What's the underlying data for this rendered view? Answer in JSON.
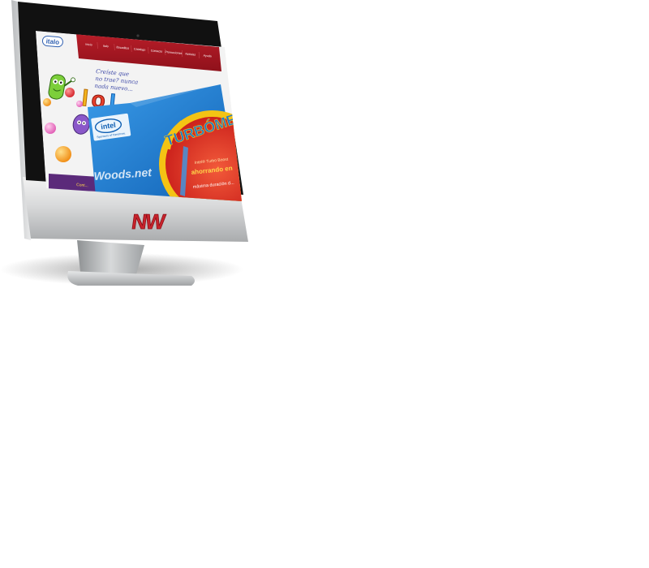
{
  "colors": {
    "nav_red": "#a51722",
    "nav_red_dark": "#7d0f18",
    "intel_blue": "#1a78d4",
    "turbo_yellow": "#f4c314",
    "turbo_red": "#e0301f",
    "brand_red": "#c8232c",
    "bezel": "#111111",
    "chin_silver": "#d9dadb"
  },
  "website": {
    "logo": "italo",
    "nav_items": [
      "Inicio",
      "Italo",
      "Bocaditos",
      "Catalogo",
      "Contacto",
      "Promociones",
      "Noticias",
      "Ayuda"
    ],
    "tagline_lines": [
      "Creíste que",
      "no trae? nunca",
      "nada nuevo..."
    ],
    "footer_snippet": "Cont..."
  },
  "ad": {
    "intel_logo": "intel",
    "intel_tagline": "Sponsors of Tomorrow.",
    "woods": "Woods.net",
    "turbo_title": "TURBÓME",
    "turbo_line1": "Intel® Turbo Boost",
    "turbo_line2": "ahorrando en",
    "turbo_line3": "máxima duración d..."
  },
  "device": {
    "chin_logo": "NW"
  },
  "icons": [
    "camera-icon",
    "candy-mascot-icon",
    "gumball-icon"
  ]
}
